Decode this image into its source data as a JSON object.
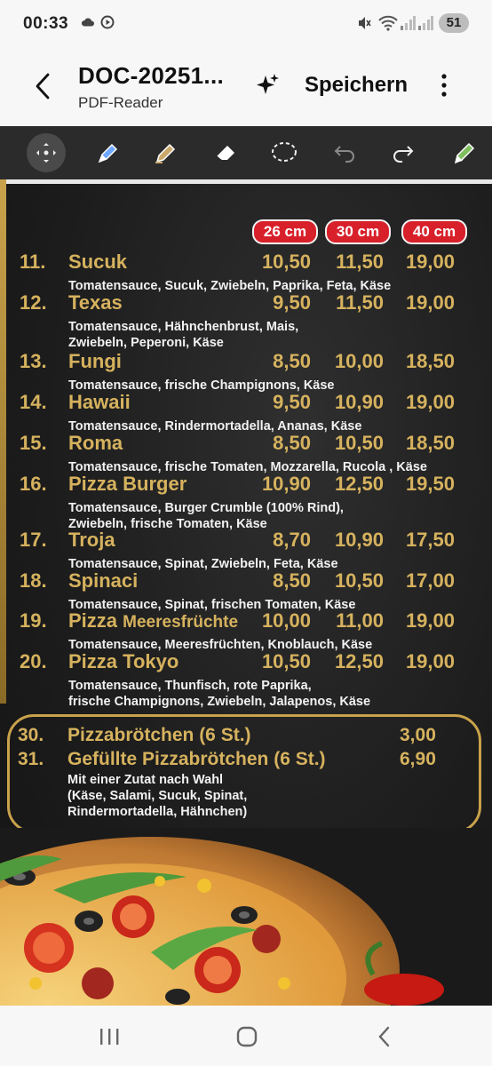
{
  "status": {
    "time": "00:33",
    "battery": "51",
    "icons": [
      "cloud-icon",
      "record-icon",
      "mute-icon",
      "wifi-icon",
      "signal-icon",
      "signal-icon",
      "battery-icon"
    ]
  },
  "appbar": {
    "title": "DOC-20251...",
    "subtitle": "PDF-Reader",
    "save_label": "Speichern"
  },
  "toolbar": {
    "tools": [
      "move-icon",
      "pen-icon",
      "highlighter-icon",
      "eraser-icon",
      "lasso-icon",
      "undo-icon",
      "redo-icon",
      "pen-settings-icon"
    ]
  },
  "document": {
    "sizes": [
      "26 cm",
      "30 cm",
      "40 cm"
    ],
    "items": [
      {
        "num": "11.",
        "name": "Sucuk",
        "p1": "10,50",
        "p2": "11,50",
        "p3": "19,00",
        "desc": [
          "Tomatensauce, Sucuk, Zwiebeln, Paprika, Feta, Käse"
        ]
      },
      {
        "num": "12.",
        "name": "Texas",
        "p1": "9,50",
        "p2": "11,50",
        "p3": "19,00",
        "desc": [
          "Tomatensauce, Hähnchenbrust, Mais,",
          "Zwiebeln, Peperoni, Käse"
        ]
      },
      {
        "num": "13.",
        "name": "Fungi",
        "p1": "8,50",
        "p2": "10,00",
        "p3": "18,50",
        "desc": [
          "Tomatensauce, frische Champignons, Käse"
        ]
      },
      {
        "num": "14.",
        "name": "Hawaii",
        "p1": "9,50",
        "p2": "10,90",
        "p3": "19,00",
        "desc": [
          "Tomatensauce, Rindermortadella,  Ananas, Käse"
        ]
      },
      {
        "num": "15.",
        "name": "Roma",
        "p1": "8,50",
        "p2": "10,50",
        "p3": "18,50",
        "desc": [
          "Tomatensauce, frische Tomaten, Mozzarella, Rucola , Käse"
        ]
      },
      {
        "num": "16.",
        "name": "Pizza Burger",
        "p1": "10,90",
        "p2": "12,50",
        "p3": "19,50",
        "desc": [
          "Tomatensauce, Burger Crumble (100% Rind),",
          "Zwiebeln, frische Tomaten, Käse"
        ]
      },
      {
        "num": "17.",
        "name": "Troja",
        "p1": "8,70",
        "p2": "10,90",
        "p3": "17,50",
        "desc": [
          "Tomatensauce, Spinat, Zwiebeln, Feta, Käse"
        ]
      },
      {
        "num": "18.",
        "name": "Spinaci",
        "p1": "8,50",
        "p2": "10,50",
        "p3": "17,00",
        "desc": [
          "Tomatensauce, Spinat, frischen Tomaten, Käse"
        ]
      },
      {
        "num": "19.",
        "name": "Pizza",
        "name_small": "Meeresfrüchte",
        "p1": "10,00",
        "p2": "11,00",
        "p3": "19,00",
        "desc": [
          "Tomatensauce, Meeresfrüchten, Knoblauch, Käse"
        ]
      },
      {
        "num": "20.",
        "name": "Pizza Tokyo",
        "p1": "10,50",
        "p2": "12,50",
        "p3": "19,00",
        "desc": [
          "Tomatensauce, Thunfisch, rote Paprika,",
          "frische Champignons, Zwiebeln, Jalapenos, Käse"
        ]
      }
    ],
    "box": {
      "row1": {
        "num": "30.",
        "name": "Pizzabrötchen (6 St.)",
        "price": "3,00"
      },
      "row2": {
        "num": "31.",
        "name": "Gefüllte Pizzabrötchen (6 St.)",
        "price": "6,90"
      },
      "desc": "Mit einer Zutat nach Wahl\n(Käse, Salami, Sucuk, Spinat,\nRindermortadella, Hähnchen)"
    }
  },
  "colors": {
    "gold": "#d6b25e",
    "badge_red": "#d8202a",
    "page_dark": "#1c1c1c",
    "toolbar": "#2b2b2b"
  }
}
